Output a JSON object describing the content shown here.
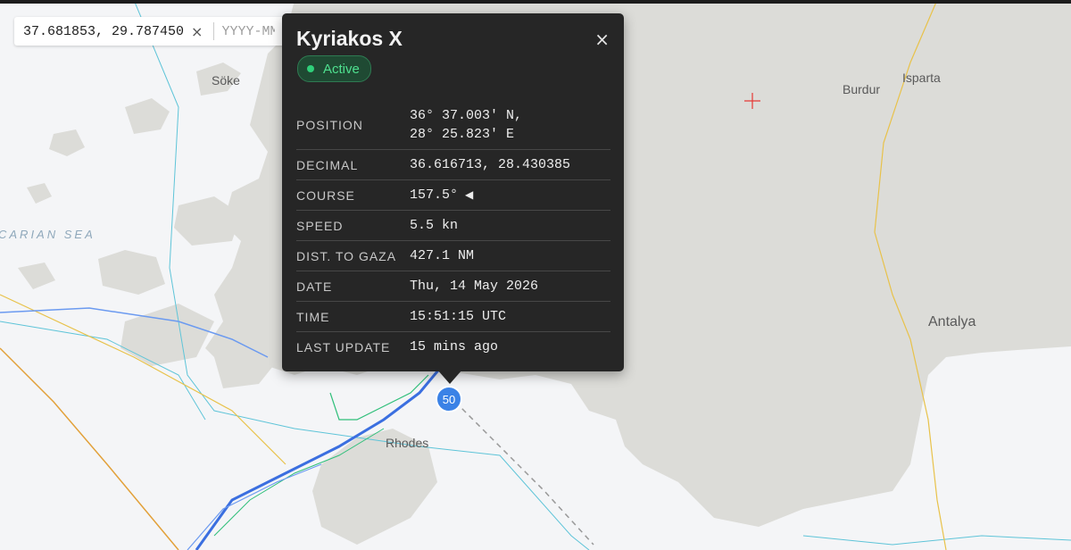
{
  "coordinate_search": {
    "value": "37.681853, 29.787450",
    "clear_icon": "×",
    "date_placeholder": "YYYY-MM-DD"
  },
  "map": {
    "labels": {
      "soke": "Söke",
      "burdur": "Burdur",
      "isparta": "Isparta",
      "antalya": "Antalya",
      "rhodes": "Rhodes",
      "sea": "CARIAN SEA"
    },
    "cluster_count": "50",
    "colors": {
      "sea": "#f4f5f7",
      "land": "#dcdcd8",
      "track_blue": "#3b6fe0",
      "track_green": "#2fbf7a",
      "track_orange": "#e2a13a",
      "road": "#e8c24a",
      "boundary": "#5ec4d8",
      "cluster": "#3b82e6",
      "marker_red": "#e53935"
    }
  },
  "popup": {
    "title": "Kyriakos X",
    "close_icon": "×",
    "status": "Active",
    "status_color": "#2fd07a",
    "rows": [
      {
        "label": "POSITION",
        "value_lines": [
          "36° 37.003' N,",
          "28° 25.823' E"
        ]
      },
      {
        "label": "DECIMAL",
        "value": "36.616713, 28.430385"
      },
      {
        "label": "COURSE",
        "value": "157.5°",
        "icon": "course-arrow-icon"
      },
      {
        "label": "SPEED",
        "value": "5.5 kn"
      },
      {
        "label": "DIST. TO GAZA",
        "value": "427.1 NM"
      },
      {
        "label": "DATE",
        "value": "Thu, 14 May 2026"
      },
      {
        "label": "TIME",
        "value": "15:51:15 UTC"
      },
      {
        "label": "LAST UPDATE",
        "value": "15 mins ago"
      }
    ]
  }
}
